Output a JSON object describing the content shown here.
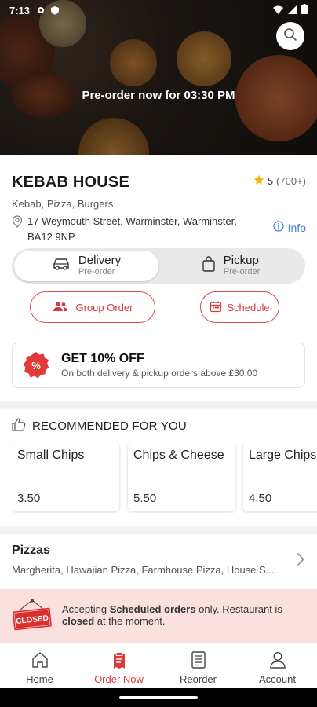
{
  "status_bar": {
    "time": "7:13"
  },
  "hero": {
    "preorder_text": "Pre-order now for 03:30 PM"
  },
  "restaurant": {
    "name": "KEBAB HOUSE",
    "rating": "5",
    "rating_count": "(700+)",
    "cuisines": "Kebab, Pizza, Burgers",
    "address": "17 Weymouth Street, Warminster, Warminster, BA12 9NP",
    "info_label": "Info"
  },
  "mode": {
    "delivery": {
      "label": "Delivery",
      "sub": "Pre-order",
      "selected": true
    },
    "pickup": {
      "label": "Pickup",
      "sub": "Pre-order",
      "selected": false
    }
  },
  "actions": {
    "group_order": "Group Order",
    "schedule": "Schedule"
  },
  "offer": {
    "title": "GET 10% OFF",
    "desc": "On both delivery & pickup orders above £30.00"
  },
  "recommended": {
    "title": "RECOMMENDED FOR YOU",
    "items": [
      {
        "name": "Small Chips",
        "price": "3.50"
      },
      {
        "name": "Chips & Cheese",
        "price": "5.50"
      },
      {
        "name": "Large Chips",
        "price": "4.50"
      }
    ]
  },
  "category": {
    "title": "Pizzas",
    "items": "Margherita, Hawaiian Pizza, Farmhouse Pizza, House S..."
  },
  "closed": {
    "sign": "CLOSED",
    "text_1": "Accepting ",
    "text_2": "Scheduled orders",
    "text_3": " only. Restaurant is ",
    "text_4": "closed",
    "text_5": " at the moment."
  },
  "nav": [
    {
      "label": "Home",
      "icon": "home-icon"
    },
    {
      "label": "Order Now",
      "icon": "order-icon"
    },
    {
      "label": "Reorder",
      "icon": "receipt-icon"
    },
    {
      "label": "Account",
      "icon": "user-icon"
    }
  ],
  "colors": {
    "accent": "#d93a3a",
    "info": "#3d7fd6",
    "closed_bg": "#fbe0e0",
    "star": "#f5b301"
  }
}
